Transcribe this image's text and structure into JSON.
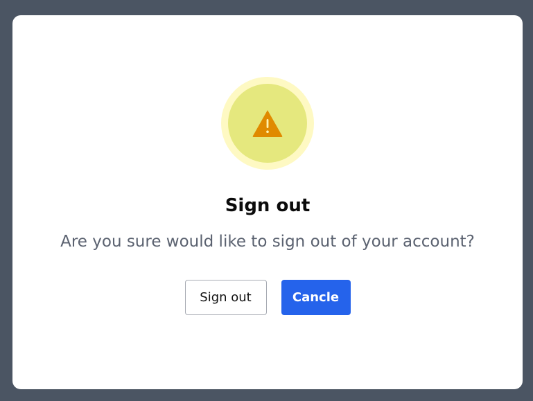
{
  "dialog": {
    "icon": "warning-triangle-icon",
    "title": "Sign out",
    "message": "Are you sure would like to sign out of your account?",
    "buttons": {
      "confirm_label": "Sign out",
      "cancel_label": "Cancle"
    }
  },
  "colors": {
    "backdrop": "#4b5563",
    "dialog_background": "#ffffff",
    "icon_ring": "#fef9c3",
    "icon_circle": "#e5e87e",
    "icon_triangle": "#e08a00",
    "primary_button": "#2563eb"
  }
}
